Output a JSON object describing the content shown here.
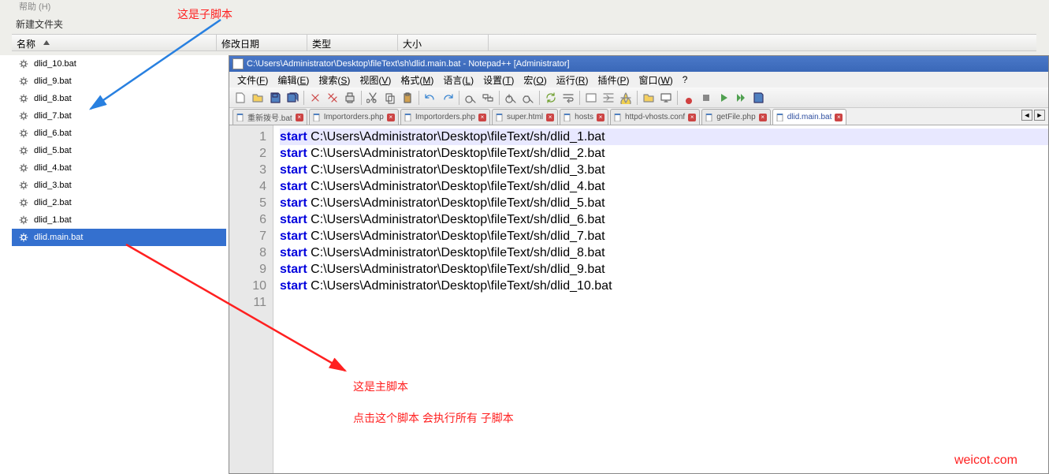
{
  "top": {
    "help": "帮助 (H)",
    "new_folder": "新建文件夹",
    "columns": {
      "name": "名称",
      "modified": "修改日期",
      "type": "类型",
      "size": "大小"
    }
  },
  "files": [
    {
      "name": "dlid_10.bat",
      "selected": false
    },
    {
      "name": "dlid_9.bat",
      "selected": false
    },
    {
      "name": "dlid_8.bat",
      "selected": false
    },
    {
      "name": "dlid_7.bat",
      "selected": false
    },
    {
      "name": "dlid_6.bat",
      "selected": false
    },
    {
      "name": "dlid_5.bat",
      "selected": false
    },
    {
      "name": "dlid_4.bat",
      "selected": false
    },
    {
      "name": "dlid_3.bat",
      "selected": false
    },
    {
      "name": "dlid_2.bat",
      "selected": false
    },
    {
      "name": "dlid_1.bat",
      "selected": false
    },
    {
      "name": "dlid.main.bat",
      "selected": true
    }
  ],
  "editor": {
    "title": "C:\\Users\\Administrator\\Desktop\\fileText\\sh\\dlid.main.bat - Notepad++ [Administrator]",
    "menus": [
      {
        "label": "文件(F)",
        "key": "F"
      },
      {
        "label": "编辑(E)",
        "key": "E"
      },
      {
        "label": "搜索(S)",
        "key": "S"
      },
      {
        "label": "视图(V)",
        "key": "V"
      },
      {
        "label": "格式(M)",
        "key": "M"
      },
      {
        "label": "语言(L)",
        "key": "L"
      },
      {
        "label": "设置(T)",
        "key": "T"
      },
      {
        "label": "宏(O)",
        "key": "O"
      },
      {
        "label": "运行(R)",
        "key": "R"
      },
      {
        "label": "插件(P)",
        "key": "P"
      },
      {
        "label": "窗口(W)",
        "key": "W"
      },
      {
        "label": "?",
        "key": ""
      }
    ],
    "tabs": [
      {
        "label": "重新拨号.bat",
        "active": false
      },
      {
        "label": "Importorders.php",
        "active": false
      },
      {
        "label": "Importorders.php",
        "active": false
      },
      {
        "label": "super.html",
        "active": false
      },
      {
        "label": "hosts",
        "active": false
      },
      {
        "label": "httpd-vhosts.conf",
        "active": false
      },
      {
        "label": "getFile.php",
        "active": false
      },
      {
        "label": "dlid.main.bat",
        "active": true
      }
    ],
    "code": [
      {
        "kw": "start",
        "rest": " C:\\Users\\Administrator\\Desktop\\fileText/sh/dlid_1.bat"
      },
      {
        "kw": "start",
        "rest": " C:\\Users\\Administrator\\Desktop\\fileText/sh/dlid_2.bat"
      },
      {
        "kw": "start",
        "rest": " C:\\Users\\Administrator\\Desktop\\fileText/sh/dlid_3.bat"
      },
      {
        "kw": "start",
        "rest": " C:\\Users\\Administrator\\Desktop\\fileText/sh/dlid_4.bat"
      },
      {
        "kw": "start",
        "rest": " C:\\Users\\Administrator\\Desktop\\fileText/sh/dlid_5.bat"
      },
      {
        "kw": "start",
        "rest": " C:\\Users\\Administrator\\Desktop\\fileText/sh/dlid_6.bat"
      },
      {
        "kw": "start",
        "rest": " C:\\Users\\Administrator\\Desktop\\fileText/sh/dlid_7.bat"
      },
      {
        "kw": "start",
        "rest": " C:\\Users\\Administrator\\Desktop\\fileText/sh/dlid_8.bat"
      },
      {
        "kw": "start",
        "rest": " C:\\Users\\Administrator\\Desktop\\fileText/sh/dlid_9.bat"
      },
      {
        "kw": "start",
        "rest": " C:\\Users\\Administrator\\Desktop\\fileText/sh/dlid_10.bat"
      }
    ]
  },
  "annotations": {
    "sub_script": "这是子脚本",
    "main_script": "这是主脚本",
    "click_hint": "点击这个脚本 会执行所有 子脚本",
    "watermark": "weicot.com"
  }
}
